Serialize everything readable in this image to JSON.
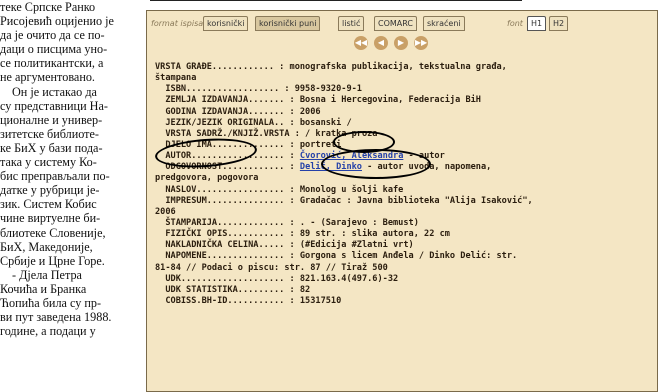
{
  "article": {
    "lines": [
      "теке Српске Ранко",
      "Рисојевић оцијенио је",
      "да је очито да се по-",
      "даци о писцима уно-",
      "се политикантски, а",
      "не аргументовано.",
      "Он је истакао да",
      "су представници На-",
      "ционалне и универ-",
      "зитетске библиоте-",
      "ке БиХ у бази пода-",
      "така у систему Ко-",
      "бис преправљали по-",
      "датке у рубрици је-",
      "зик. Систем Кобис",
      "чине виртуелне би-",
      "блиотеке Словеније,",
      "БиХ, Македоније,",
      "Србије и Црне Горе.",
      "- Дјела Петра",
      "Кочића и Бранка",
      "Ћопића била су пр-",
      "ви пут заведена 1988.",
      "године, а подаци у"
    ]
  },
  "catalog": {
    "format_label": "format ispisa",
    "format_tabs": [
      "korisnički",
      "korisnički puni",
      "listić",
      "COMARC",
      "skraćeni"
    ],
    "font_label": "font",
    "font_tabs": [
      "H1",
      "H2"
    ],
    "nav_buttons": [
      "first-icon",
      "prev-icon",
      "next-icon",
      "last-icon"
    ],
    "nav_glyphs": [
      "◀◀",
      "◀",
      "▶",
      "▶▶"
    ],
    "rows": [
      {
        "key": "VRSTA GRAĐE............ :",
        "val": " monografska publikacija, tekstualna građa,"
      },
      {
        "key": "štampana",
        "val": ""
      },
      {
        "key": "  ISBN.................. :",
        "val": " 9958-9320-9-1"
      },
      {
        "key": "  ZEMLJA IZDAVANJA....... :",
        "val": " Bosna i Hercegovina, Federacija BiH"
      },
      {
        "key": "  GODINA IZDAVANJA....... :",
        "val": " 2006"
      },
      {
        "key": "  JEZIK/JEZIK ORIGINALA.. :",
        "val": " bosanski /"
      },
      {
        "key": "  VRSTA SADRŽ./KNJIŽ.VRSTA :",
        "val": " / kratka proza"
      },
      {
        "key": "  DJELO IMA.............. :",
        "val": " portreti"
      },
      {
        "key": "  AUTOR.................. :",
        "val": " ",
        "link": "Čvorović, Aleksandra",
        "tail": " - autor"
      },
      {
        "key": "  ODGOVORNOST............ :",
        "val": " ",
        "link": "Delić, Dinko",
        "tail": " - autor uvoda, napomena,"
      },
      {
        "key": "predgovora, pogovora",
        "val": ""
      },
      {
        "key": "  NASLOV................. :",
        "val": " Monolog u šolji kafe"
      },
      {
        "key": "  IMPRESUM............... :",
        "val": " Gradačac : Javna biblioteka \"Alija Isaković\","
      },
      {
        "key": "2006",
        "val": ""
      },
      {
        "key": "  ŠTAMPARIJA............. :",
        "val": " . - (Sarajevo : Bemust)"
      },
      {
        "key": "  FIZIČKI OPIS........... :",
        "val": " 89 str. : slika autora, 22 cm"
      },
      {
        "key": "  NAKLADNIČKA CELINA..... :",
        "val": " (#Edicija #Zlatni vrt)"
      },
      {
        "key": "  NAPOMENE............... :",
        "val": " Gorgona s licem Anđela / Dinko Delić: str."
      },
      {
        "key": "81-84 // Podaci o piscu: str. 87 // Tiraž 500",
        "val": ""
      },
      {
        "key": "  UDK.................... :",
        "val": " 821.163.4(497.6)-32"
      },
      {
        "key": "  UDK STATISTIKA......... :",
        "val": " 82"
      },
      {
        "key": "  COBISS.BH-ID........... :",
        "val": " 15317510"
      }
    ]
  }
}
